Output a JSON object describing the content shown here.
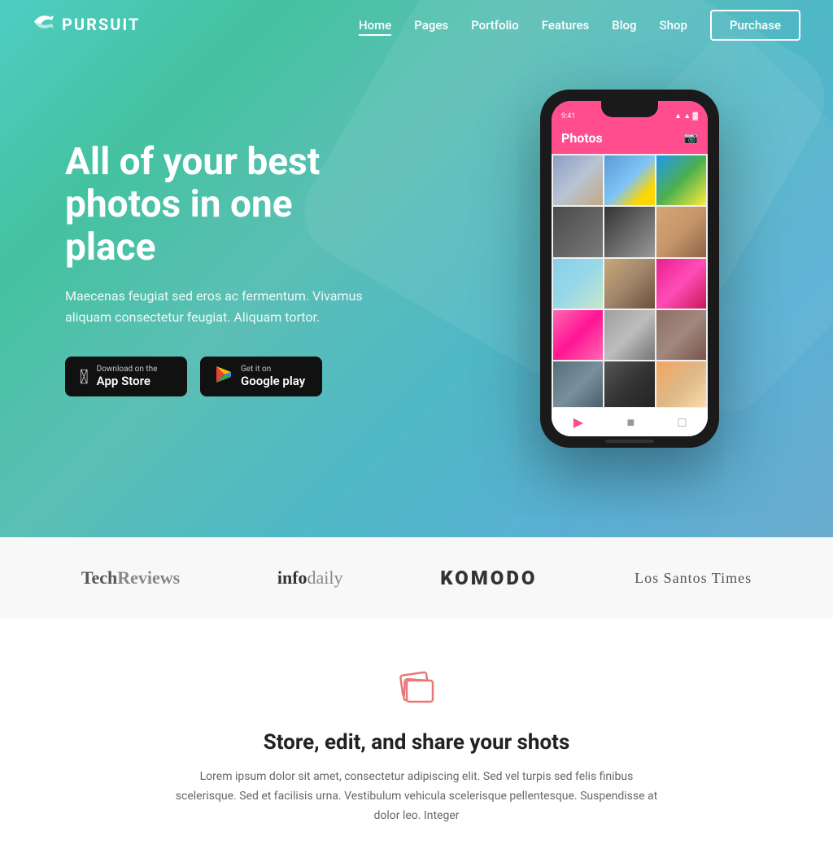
{
  "brand": {
    "name": "PURSUIT",
    "logo_icon": "✈"
  },
  "nav": {
    "links": [
      {
        "label": "Home",
        "active": true
      },
      {
        "label": "Pages",
        "active": false
      },
      {
        "label": "Portfolio",
        "active": false
      },
      {
        "label": "Features",
        "active": false
      },
      {
        "label": "Blog",
        "active": false
      },
      {
        "label": "Shop",
        "active": false
      }
    ],
    "purchase_label": "Purchase"
  },
  "hero": {
    "title": "All of your best photos in one place",
    "subtitle": "Maecenas feugiat sed eros ac fermentum. Vivamus aliquam consectetur feugiat. Aliquam tortor.",
    "appstore_small": "Download on the",
    "appstore_big": "App Store",
    "google_small": "Get it on",
    "google_big": "Google play"
  },
  "phone": {
    "status_time": "9:41",
    "header_title": "Photos",
    "photos": [
      "photo-eiffel",
      "photo-balloon",
      "photo-parrot",
      "photo-cat2",
      "photo-guy",
      "photo-coffee",
      "photo-beach",
      "photo-cat",
      "photo-pink",
      "photo-pool",
      "photo-winter",
      "photo-dog",
      "photo-street",
      "photo-legs",
      "photo-woman"
    ]
  },
  "brands": [
    {
      "key": "techreviews",
      "label": "TechReviews",
      "bold_prefix": "Tech",
      "rest": "Reviews"
    },
    {
      "key": "infodaily",
      "label": "infodaily",
      "bold_part": "info",
      "rest": "daily"
    },
    {
      "key": "komodo",
      "label": "KOMODO"
    },
    {
      "key": "lossantos",
      "label": "Los Santos Times"
    }
  ],
  "features": {
    "icon_label": "photos-icon",
    "title": "Store, edit, and share your shots",
    "description": "Lorem ipsum dolor sit amet, consectetur adipiscing elit. Sed vel turpis sed felis finibus scelerisque. Sed et facilisis urna. Vestibulum vehicula scelerisque pellentesque. Suspendisse at dolor leo. Integer"
  }
}
